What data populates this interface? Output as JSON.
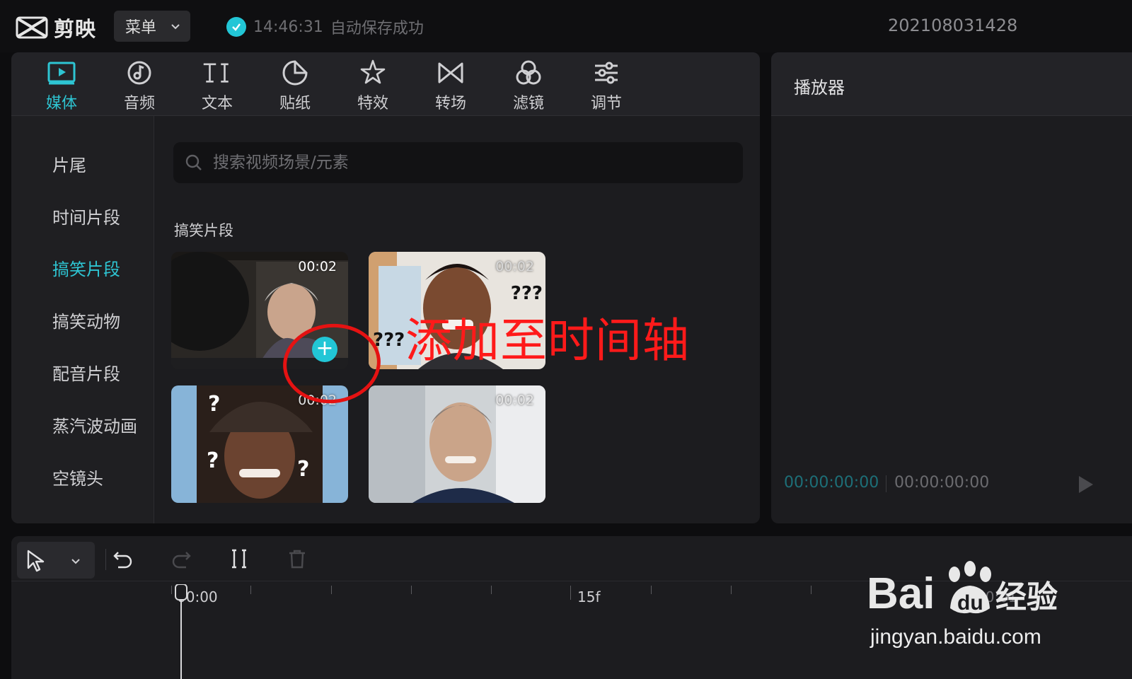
{
  "app": {
    "name": "剪映",
    "menu_label": "菜单",
    "save_time": "14:46:31",
    "save_text": "自动保存成功",
    "project_name": "202108031428"
  },
  "tabs": [
    {
      "label": "媒体",
      "icon": "media-icon",
      "active": true
    },
    {
      "label": "音频",
      "icon": "audio-icon"
    },
    {
      "label": "文本",
      "icon": "text-icon"
    },
    {
      "label": "贴纸",
      "icon": "sticker-icon"
    },
    {
      "label": "特效",
      "icon": "effects-icon"
    },
    {
      "label": "转场",
      "icon": "transition-icon"
    },
    {
      "label": "滤镜",
      "icon": "filter-icon"
    },
    {
      "label": "调节",
      "icon": "adjust-icon"
    }
  ],
  "categories": [
    "片尾",
    "时间片段",
    "搞笑片段",
    "搞笑动物",
    "配音片段",
    "蒸汽波动画",
    "空镜头"
  ],
  "active_category": "搞笑片段",
  "search": {
    "placeholder": "搜索视频场景/元素"
  },
  "section_title": "搞笑片段",
  "clips": [
    {
      "duration": "00:02",
      "caption": ""
    },
    {
      "duration": "00:02",
      "caption": "???"
    },
    {
      "duration": "00:02",
      "caption": "?"
    },
    {
      "duration": "00:02",
      "caption": ""
    }
  ],
  "clip_marks": {
    "left": "???",
    "right": "???",
    "q": "?"
  },
  "player": {
    "title": "播放器",
    "current_time": "00:00:00:00",
    "total_time": "00:00:00:00"
  },
  "timeline": {
    "labels": [
      "00:00",
      "15f",
      "00:01"
    ]
  },
  "annotation": {
    "text": "添加至时间轴"
  },
  "watermark": {
    "brand": "Bai",
    "brand_suffix": "经验",
    "url": "jingyan.baidu.com"
  },
  "colors": {
    "accent": "#2ec5d3",
    "annotation": "#ff1a1a"
  }
}
